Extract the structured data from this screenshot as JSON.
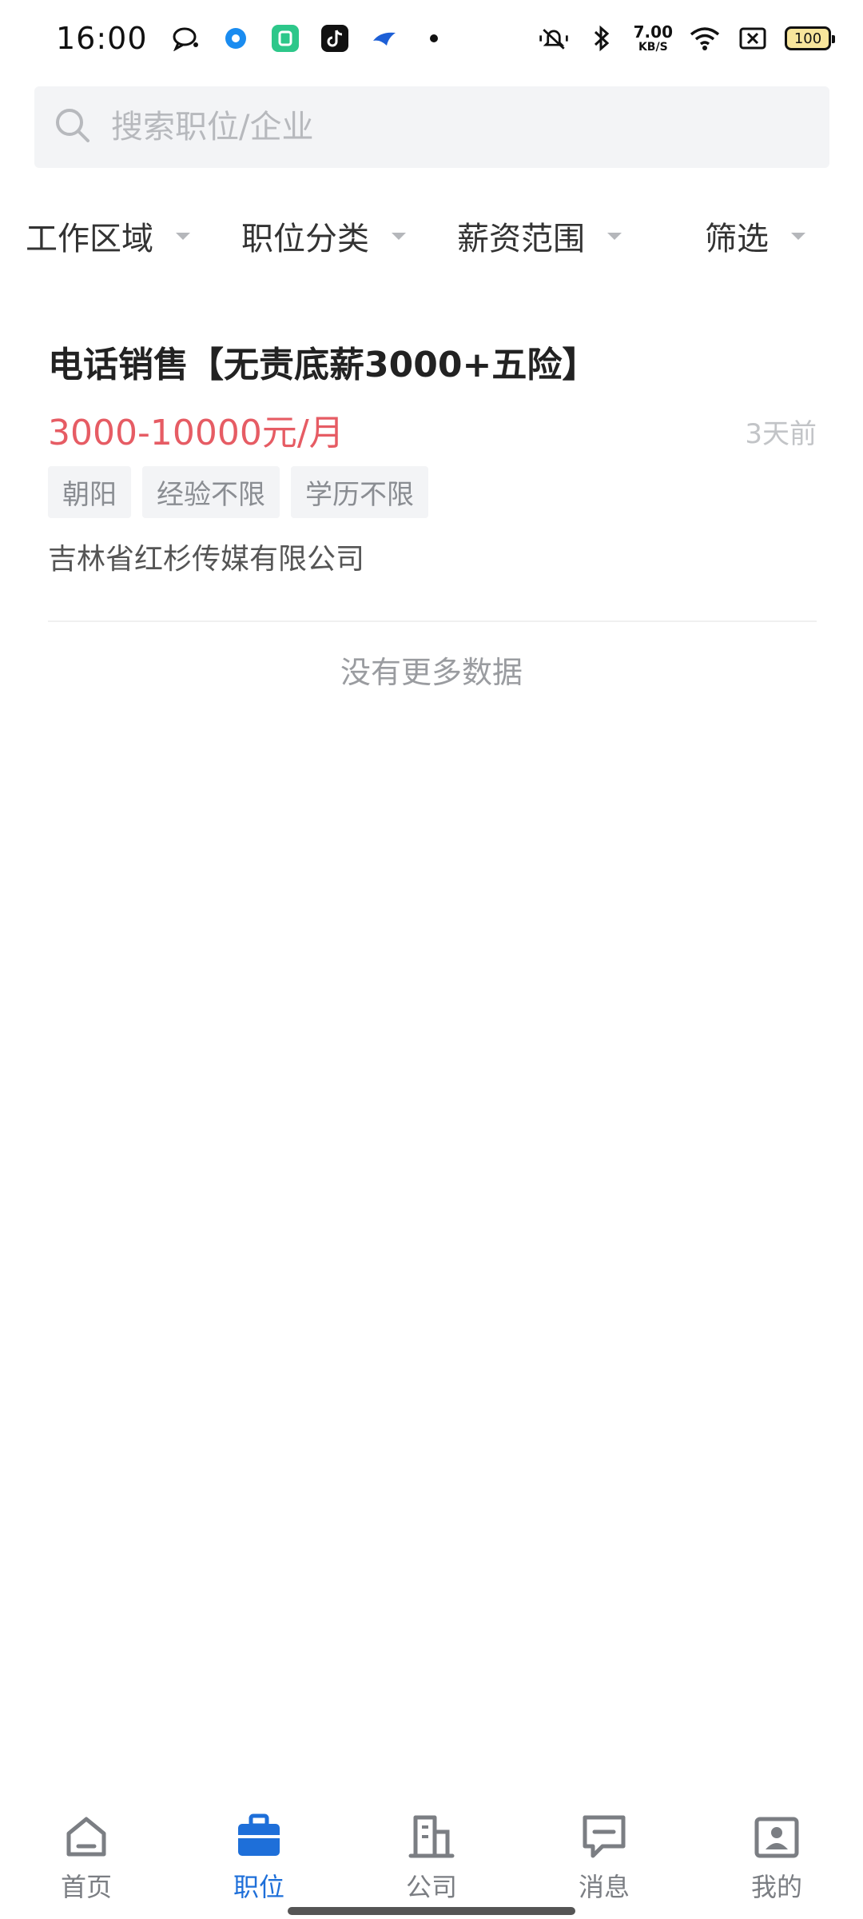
{
  "status_bar": {
    "time": "16:00",
    "net_speed_value": "7.00",
    "net_speed_unit": "KB/S",
    "battery": "100"
  },
  "search": {
    "placeholder": "搜索职位/企业"
  },
  "filters": [
    {
      "label": "工作区域"
    },
    {
      "label": "职位分类"
    },
    {
      "label": "薪资范围"
    },
    {
      "label": "筛选"
    }
  ],
  "job": {
    "title": "电话销售【无责底薪3000+五险】",
    "salary": "3000-10000元/月",
    "posted": "3天前",
    "tags": [
      "朝阳",
      "经验不限",
      "学历不限"
    ],
    "company": "吉林省红杉传媒有限公司"
  },
  "list_end_text": "没有更多数据",
  "nav": [
    {
      "label": "首页",
      "icon": "home-icon"
    },
    {
      "label": "职位",
      "icon": "briefcase-icon",
      "active": true
    },
    {
      "label": "公司",
      "icon": "building-icon"
    },
    {
      "label": "消息",
      "icon": "message-icon"
    },
    {
      "label": "我的",
      "icon": "profile-icon"
    }
  ],
  "colors": {
    "accent": "#1e6fd9",
    "salary": "#e65c64"
  }
}
